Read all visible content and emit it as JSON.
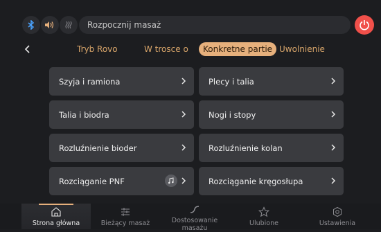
{
  "topbar": {
    "search_text": "Rozpocznij masaż",
    "icons": [
      "bluetooth-icon",
      "volume-icon",
      "heat-icon",
      "power-icon"
    ]
  },
  "tabs": [
    {
      "label": "Tryb Rovo",
      "active": false
    },
    {
      "label": "W trosce o",
      "active": false
    },
    {
      "label": "Konkretne partie",
      "active": true
    },
    {
      "label": "Uwolnienie",
      "active": false
    }
  ],
  "cards": [
    {
      "label": "Szyja i ramiona"
    },
    {
      "label": "Plecy i talia"
    },
    {
      "label": "Talia i biodra"
    },
    {
      "label": "Nogi i stopy"
    },
    {
      "label": "Rozluźnienie bioder"
    },
    {
      "label": "Rozluźnienie kolan"
    },
    {
      "label": "Rozciąganie PNF",
      "has_music_icon": true
    },
    {
      "label": "Rozciąganie kręgosłupa"
    }
  ],
  "bottom_nav": [
    {
      "label": "Strona główna",
      "icon": "home-icon",
      "active": true
    },
    {
      "label": "Bieżący masaż",
      "icon": "sliders-icon",
      "active": false
    },
    {
      "label": "Dostosowanie masażu",
      "icon": "custom-curve-icon",
      "active": false
    },
    {
      "label": "Ulubione",
      "icon": "star-icon",
      "active": false
    },
    {
      "label": "Ustawienia",
      "icon": "settings-icon",
      "active": false
    }
  ],
  "colors": {
    "accent": "#e6b07c",
    "power": "#f0504a",
    "card": "#3a3b3f",
    "background": "#1c1d20"
  }
}
